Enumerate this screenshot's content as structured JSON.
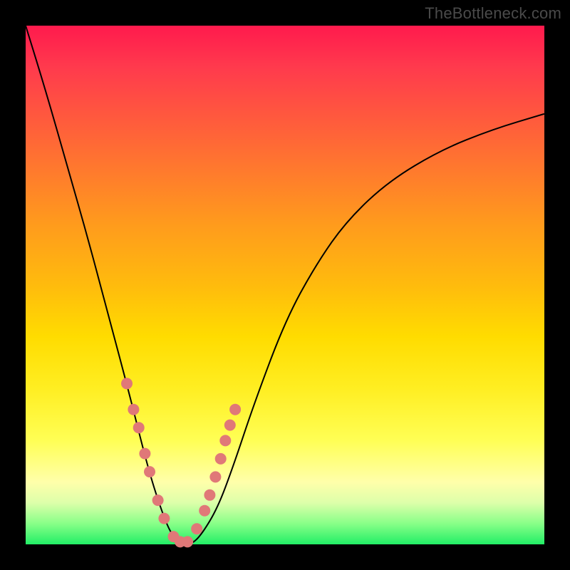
{
  "watermark": "TheBottleneck.com",
  "chart_data": {
    "type": "line",
    "title": "",
    "xlabel": "",
    "ylabel": "",
    "x_range": [
      0,
      1
    ],
    "y_range": [
      0,
      1
    ],
    "background_gradient": {
      "top": "#ff1a4d",
      "upper_mid": "#ff9a1d",
      "lower_mid": "#ffff55",
      "bottom": "#22ee66"
    },
    "series": [
      {
        "name": "bottleneck-curve",
        "x": [
          0.0,
          0.04,
          0.08,
          0.12,
          0.16,
          0.2,
          0.235,
          0.26,
          0.28,
          0.3,
          0.32,
          0.34,
          0.37,
          0.4,
          0.44,
          0.5,
          0.56,
          0.62,
          0.7,
          0.8,
          0.9,
          1.0
        ],
        "y": [
          1.0,
          0.87,
          0.73,
          0.59,
          0.44,
          0.29,
          0.15,
          0.07,
          0.02,
          0.0,
          0.0,
          0.02,
          0.07,
          0.15,
          0.27,
          0.43,
          0.54,
          0.625,
          0.7,
          0.76,
          0.8,
          0.83
        ]
      }
    ],
    "markers": {
      "name": "highlight-points",
      "color": "#e07878",
      "x": [
        0.195,
        0.208,
        0.218,
        0.23,
        0.239,
        0.255,
        0.267,
        0.285,
        0.298,
        0.312,
        0.33,
        0.345,
        0.355,
        0.366,
        0.376,
        0.385,
        0.394,
        0.404
      ],
      "y": [
        0.31,
        0.26,
        0.225,
        0.175,
        0.14,
        0.085,
        0.05,
        0.015,
        0.005,
        0.005,
        0.03,
        0.065,
        0.095,
        0.13,
        0.165,
        0.2,
        0.23,
        0.26
      ]
    }
  }
}
